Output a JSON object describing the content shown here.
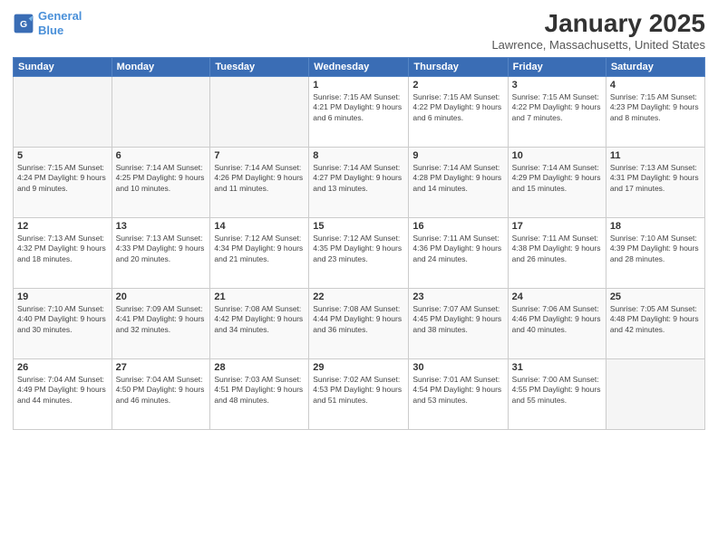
{
  "header": {
    "logo_line1": "General",
    "logo_line2": "Blue",
    "month": "January 2025",
    "location": "Lawrence, Massachusetts, United States"
  },
  "weekdays": [
    "Sunday",
    "Monday",
    "Tuesday",
    "Wednesday",
    "Thursday",
    "Friday",
    "Saturday"
  ],
  "weeks": [
    [
      {
        "day": "",
        "info": ""
      },
      {
        "day": "",
        "info": ""
      },
      {
        "day": "",
        "info": ""
      },
      {
        "day": "1",
        "info": "Sunrise: 7:15 AM\nSunset: 4:21 PM\nDaylight: 9 hours\nand 6 minutes."
      },
      {
        "day": "2",
        "info": "Sunrise: 7:15 AM\nSunset: 4:22 PM\nDaylight: 9 hours\nand 6 minutes."
      },
      {
        "day": "3",
        "info": "Sunrise: 7:15 AM\nSunset: 4:22 PM\nDaylight: 9 hours\nand 7 minutes."
      },
      {
        "day": "4",
        "info": "Sunrise: 7:15 AM\nSunset: 4:23 PM\nDaylight: 9 hours\nand 8 minutes."
      }
    ],
    [
      {
        "day": "5",
        "info": "Sunrise: 7:15 AM\nSunset: 4:24 PM\nDaylight: 9 hours\nand 9 minutes."
      },
      {
        "day": "6",
        "info": "Sunrise: 7:14 AM\nSunset: 4:25 PM\nDaylight: 9 hours\nand 10 minutes."
      },
      {
        "day": "7",
        "info": "Sunrise: 7:14 AM\nSunset: 4:26 PM\nDaylight: 9 hours\nand 11 minutes."
      },
      {
        "day": "8",
        "info": "Sunrise: 7:14 AM\nSunset: 4:27 PM\nDaylight: 9 hours\nand 13 minutes."
      },
      {
        "day": "9",
        "info": "Sunrise: 7:14 AM\nSunset: 4:28 PM\nDaylight: 9 hours\nand 14 minutes."
      },
      {
        "day": "10",
        "info": "Sunrise: 7:14 AM\nSunset: 4:29 PM\nDaylight: 9 hours\nand 15 minutes."
      },
      {
        "day": "11",
        "info": "Sunrise: 7:13 AM\nSunset: 4:31 PM\nDaylight: 9 hours\nand 17 minutes."
      }
    ],
    [
      {
        "day": "12",
        "info": "Sunrise: 7:13 AM\nSunset: 4:32 PM\nDaylight: 9 hours\nand 18 minutes."
      },
      {
        "day": "13",
        "info": "Sunrise: 7:13 AM\nSunset: 4:33 PM\nDaylight: 9 hours\nand 20 minutes."
      },
      {
        "day": "14",
        "info": "Sunrise: 7:12 AM\nSunset: 4:34 PM\nDaylight: 9 hours\nand 21 minutes."
      },
      {
        "day": "15",
        "info": "Sunrise: 7:12 AM\nSunset: 4:35 PM\nDaylight: 9 hours\nand 23 minutes."
      },
      {
        "day": "16",
        "info": "Sunrise: 7:11 AM\nSunset: 4:36 PM\nDaylight: 9 hours\nand 24 minutes."
      },
      {
        "day": "17",
        "info": "Sunrise: 7:11 AM\nSunset: 4:38 PM\nDaylight: 9 hours\nand 26 minutes."
      },
      {
        "day": "18",
        "info": "Sunrise: 7:10 AM\nSunset: 4:39 PM\nDaylight: 9 hours\nand 28 minutes."
      }
    ],
    [
      {
        "day": "19",
        "info": "Sunrise: 7:10 AM\nSunset: 4:40 PM\nDaylight: 9 hours\nand 30 minutes."
      },
      {
        "day": "20",
        "info": "Sunrise: 7:09 AM\nSunset: 4:41 PM\nDaylight: 9 hours\nand 32 minutes."
      },
      {
        "day": "21",
        "info": "Sunrise: 7:08 AM\nSunset: 4:42 PM\nDaylight: 9 hours\nand 34 minutes."
      },
      {
        "day": "22",
        "info": "Sunrise: 7:08 AM\nSunset: 4:44 PM\nDaylight: 9 hours\nand 36 minutes."
      },
      {
        "day": "23",
        "info": "Sunrise: 7:07 AM\nSunset: 4:45 PM\nDaylight: 9 hours\nand 38 minutes."
      },
      {
        "day": "24",
        "info": "Sunrise: 7:06 AM\nSunset: 4:46 PM\nDaylight: 9 hours\nand 40 minutes."
      },
      {
        "day": "25",
        "info": "Sunrise: 7:05 AM\nSunset: 4:48 PM\nDaylight: 9 hours\nand 42 minutes."
      }
    ],
    [
      {
        "day": "26",
        "info": "Sunrise: 7:04 AM\nSunset: 4:49 PM\nDaylight: 9 hours\nand 44 minutes."
      },
      {
        "day": "27",
        "info": "Sunrise: 7:04 AM\nSunset: 4:50 PM\nDaylight: 9 hours\nand 46 minutes."
      },
      {
        "day": "28",
        "info": "Sunrise: 7:03 AM\nSunset: 4:51 PM\nDaylight: 9 hours\nand 48 minutes."
      },
      {
        "day": "29",
        "info": "Sunrise: 7:02 AM\nSunset: 4:53 PM\nDaylight: 9 hours\nand 51 minutes."
      },
      {
        "day": "30",
        "info": "Sunrise: 7:01 AM\nSunset: 4:54 PM\nDaylight: 9 hours\nand 53 minutes."
      },
      {
        "day": "31",
        "info": "Sunrise: 7:00 AM\nSunset: 4:55 PM\nDaylight: 9 hours\nand 55 minutes."
      },
      {
        "day": "",
        "info": ""
      }
    ]
  ]
}
